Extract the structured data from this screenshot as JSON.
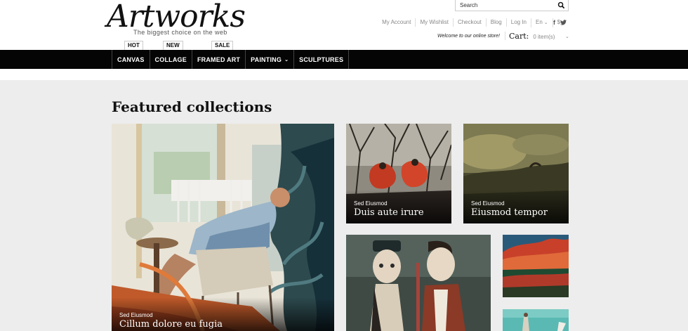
{
  "brand": {
    "logo_text": "Artworks",
    "tagline": "The biggest choice on the web"
  },
  "search": {
    "placeholder": "Search",
    "icon": "search-icon"
  },
  "toplinks": {
    "my_account": "My Account",
    "my_wishlist": "My Wishlist",
    "checkout": "Checkout",
    "blog": "Blog",
    "login": "Log In",
    "language": "En",
    "currency": "$"
  },
  "social": {
    "facebook": "f",
    "twitter": "t"
  },
  "welcome": "Welcome to our online store!",
  "cart": {
    "label": "Cart:",
    "count": "0 item(s)"
  },
  "nav": {
    "items": [
      {
        "label": "CANVAS",
        "badge": "HOT"
      },
      {
        "label": "COLLAGE",
        "badge": "NEW"
      },
      {
        "label": "FRAMED ART",
        "badge": "SALE"
      },
      {
        "label": "PAINTING",
        "badge": ""
      },
      {
        "label": "SCULPTURES",
        "badge": ""
      }
    ]
  },
  "featured": {
    "heading": "Featured collections",
    "tiles": [
      {
        "subtitle": "Sed Eiusmod",
        "title": "Cillum dolore eu fugia"
      },
      {
        "subtitle": "Sed Eiusmod",
        "title": "Duis aute irure"
      },
      {
        "subtitle": "Sed Eiusmod",
        "title": "Eiusmod tempor"
      }
    ]
  },
  "colors": {
    "nav_bg": "#050505",
    "page_bg": "#ededed",
    "text_dark": "#111111",
    "link_gray": "#888888"
  }
}
